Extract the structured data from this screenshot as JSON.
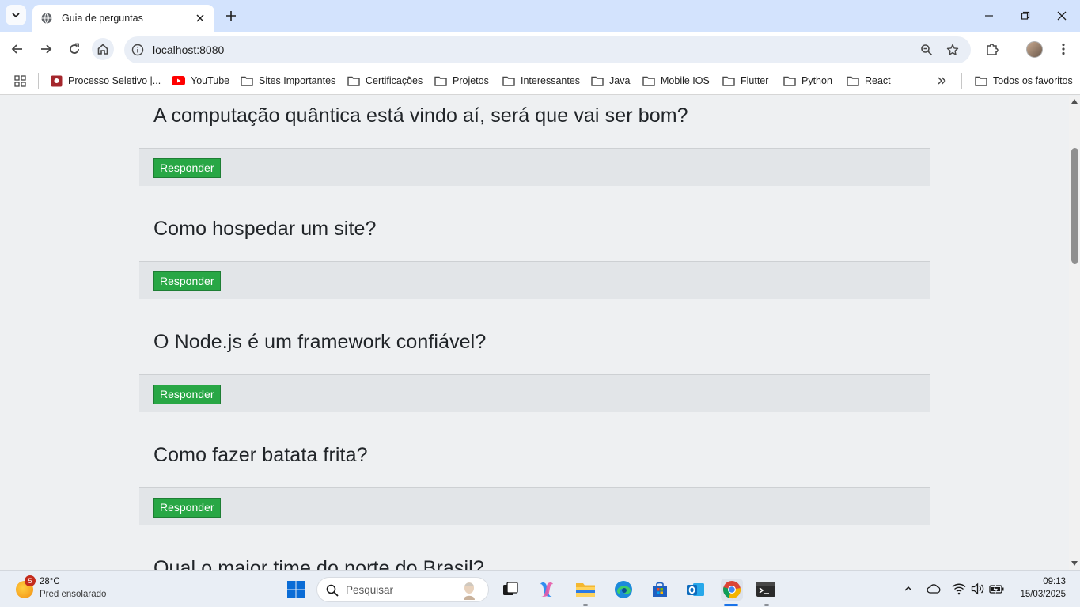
{
  "browser": {
    "tab_title": "Guia de perguntas",
    "url": "localhost:8080"
  },
  "bookmarks": [
    {
      "label": "Processo Seletivo |...",
      "icon": "site-favicon-icon"
    },
    {
      "label": "YouTube",
      "icon": "youtube-icon"
    },
    {
      "label": "Sites Importantes",
      "icon": "folder-icon"
    },
    {
      "label": "Certificações",
      "icon": "folder-icon"
    },
    {
      "label": "Projetos",
      "icon": "folder-icon"
    },
    {
      "label": "Interessantes",
      "icon": "folder-icon"
    },
    {
      "label": "Java",
      "icon": "folder-icon"
    },
    {
      "label": "Mobile IOS",
      "icon": "folder-icon"
    },
    {
      "label": "Flutter",
      "icon": "folder-icon"
    },
    {
      "label": "Python",
      "icon": "folder-icon"
    },
    {
      "label": "React",
      "icon": "folder-icon"
    }
  ],
  "all_bookmarks_label": "Todos os favoritos",
  "questions": [
    {
      "title": "A computação quântica está vindo aí, será que vai ser bom?",
      "button": "Responder"
    },
    {
      "title": "Como hospedar um site?",
      "button": "Responder"
    },
    {
      "title": "O Node.js é um framework confiável?",
      "button": "Responder"
    },
    {
      "title": "Como fazer batata frita?",
      "button": "Responder"
    },
    {
      "title": "Qual o maior time do norte do Brasil?",
      "button": "Responder"
    }
  ],
  "taskbar": {
    "weather_badge": "5",
    "weather_temp": "28°C",
    "weather_desc": "Pred ensolarado",
    "search_placeholder": "Pesquisar",
    "time": "09:13",
    "date": "15/03/2025"
  },
  "colors": {
    "responder_button": "#28a745",
    "page_background": "#eef0f2",
    "card_footer": "#e2e5e8"
  }
}
